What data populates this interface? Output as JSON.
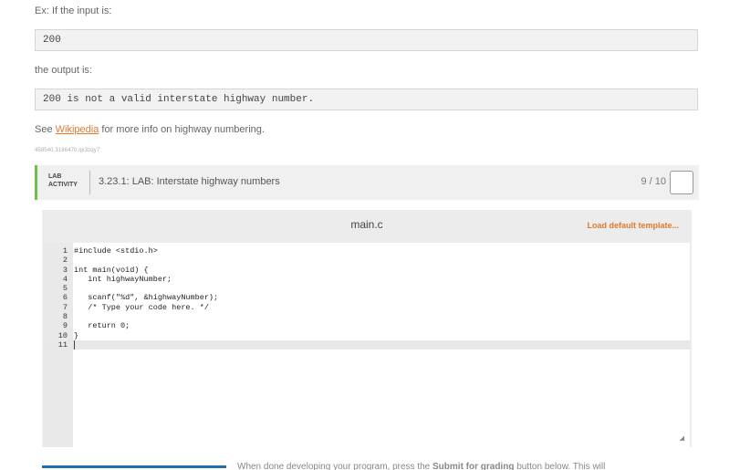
{
  "example": {
    "intro": "Ex: If the input is:",
    "input_value": "200",
    "output_intro": "the output is:",
    "output_value": "200 is not a valid interstate highway number.",
    "see_prefix": "See ",
    "see_link": "Wikipedia",
    "see_suffix": " for more info on highway numbering.",
    "tracking_id": "458540.3186470.qx3zqy7"
  },
  "lab": {
    "tag_line1": "LAB",
    "tag_line2": "ACTIVITY",
    "title": "3.23.1: LAB: Interstate highway numbers",
    "score": "9 / 10",
    "accent_color": "#6fbf4a"
  },
  "editor": {
    "file_name": "main.c",
    "load_default": "Load default template...",
    "lines": [
      {
        "n": "1",
        "code": "#include <stdio.h>"
      },
      {
        "n": "2",
        "code": ""
      },
      {
        "n": "3",
        "code": "int main(void) {"
      },
      {
        "n": "4",
        "code": "   int highwayNumber;"
      },
      {
        "n": "5",
        "code": ""
      },
      {
        "n": "6",
        "code": "   scanf(\"%d\", &highwayNumber);"
      },
      {
        "n": "7",
        "code": "   /* Type your code here. */"
      },
      {
        "n": "8",
        "code": ""
      },
      {
        "n": "9",
        "code": "   return 0;"
      },
      {
        "n": "10",
        "code": "}"
      },
      {
        "n": "11",
        "code": ""
      }
    ]
  },
  "footer": {
    "text_prefix": "When done developing your program, press the ",
    "text_bold": "Submit for grading",
    "text_suffix": " button below. This will"
  },
  "colors": {
    "link": "#e07a2e",
    "button_blue": "#1d6fb8"
  }
}
